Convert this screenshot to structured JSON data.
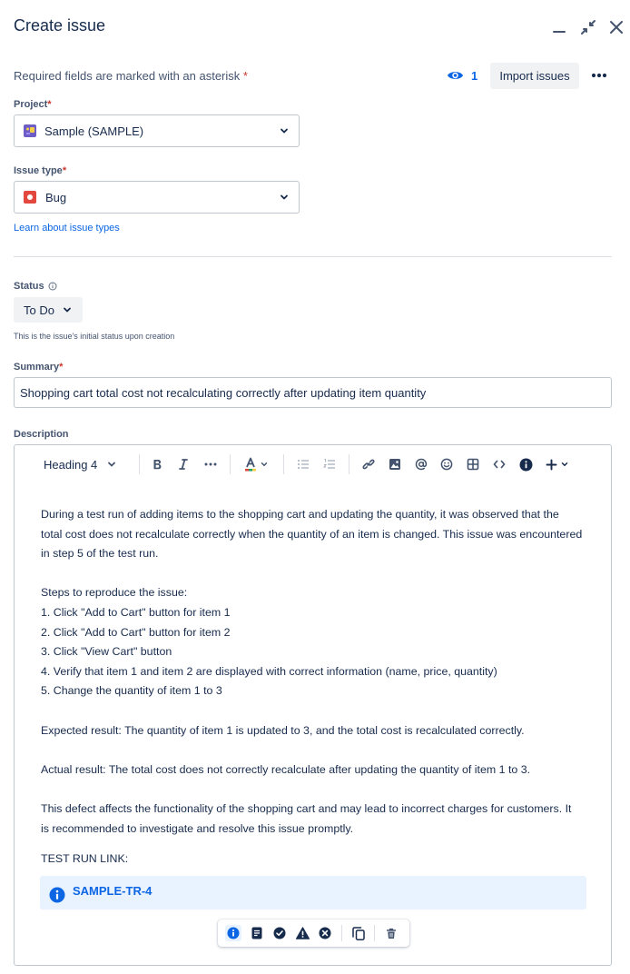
{
  "header": {
    "title": "Create issue"
  },
  "required_note": {
    "text": "Required fields are marked with an asterisk",
    "asterisk": "*"
  },
  "watchers": {
    "count": "1"
  },
  "actions": {
    "import_label": "Import issues"
  },
  "project": {
    "label": "Project",
    "value": "Sample (SAMPLE)"
  },
  "issue_type": {
    "label": "Issue type",
    "value": "Bug",
    "learn_link": "Learn about issue types"
  },
  "status": {
    "label": "Status",
    "value": "To Do",
    "hint": "This is the issue's initial status upon creation"
  },
  "summary": {
    "label": "Summary",
    "value": "Shopping cart total cost not recalculating correctly after updating item quantity"
  },
  "description": {
    "label": "Description",
    "toolbar": {
      "text_style": "Heading 4"
    },
    "paragraphs": [
      "During a test run of adding items to the shopping cart and updating the quantity, it was observed that the",
      "total cost does not recalculate correctly when the quantity of an item is changed. This issue was encountered",
      "in step 5 of the test run.",
      "",
      "Steps to reproduce the issue:",
      "1. Click \"Add to Cart\" button for item 1",
      "2. Click \"Add to Cart\" button for item 2",
      "3. Click \"View Cart\" button",
      "4. Verify that item 1 and item 2 are displayed with correct information (name, price, quantity)",
      "5. Change the quantity of item 1 to 3",
      "",
      "Expected result: The quantity of item 1 is updated to 3, and the total cost is recalculated correctly.",
      "",
      "Actual result: The total cost does not correctly recalculate after updating the quantity of item 1 to 3.",
      "",
      "This defect affects the functionality of the shopping cart and may lead to incorrect charges for customers. It",
      "is recommended to investigate and resolve this issue promptly."
    ],
    "test_run_label": "TEST RUN LINK:",
    "panel_link": "SAMPLE-TR-4"
  },
  "colors": {
    "accent": "#0c66e4",
    "required": "#c9372c",
    "bug": "#e2483d",
    "project_icon": "#6e5dc6"
  }
}
